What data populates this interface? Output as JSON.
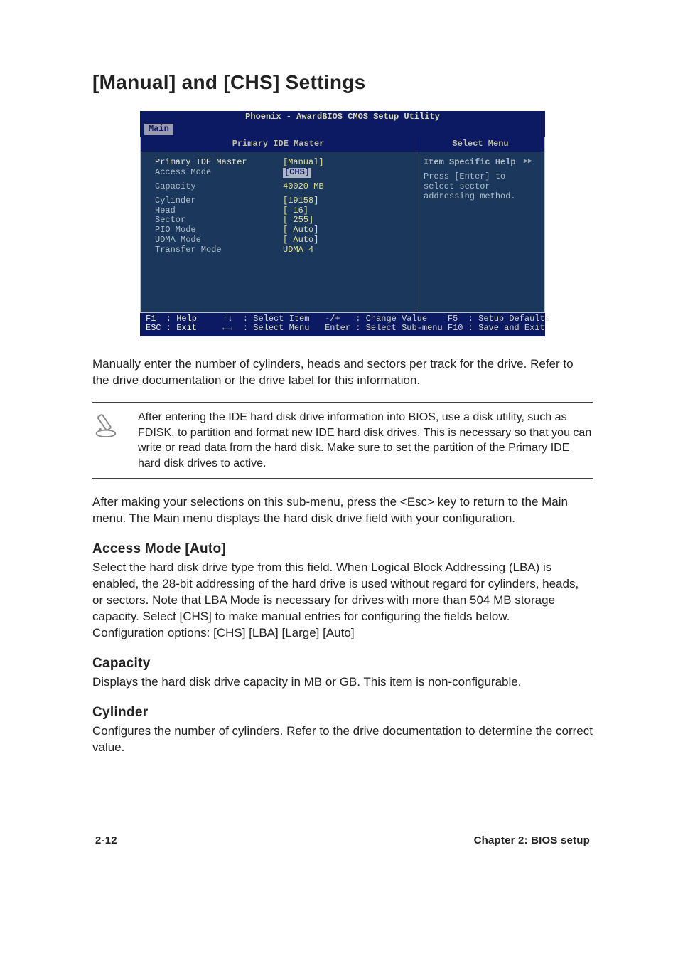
{
  "title": "[Manual] and [CHS] Settings",
  "bios": {
    "header": "Phoenix - AwardBIOS CMOS Setup Utility",
    "tab": "Main",
    "left_head": "Primary IDE Master",
    "right_head": "Select Menu",
    "rows": {
      "primary_label": "Primary IDE Master",
      "primary_val": "[Manual]",
      "access_label": "Access Mode",
      "access_val": "[CHS]",
      "capacity_label": "Capacity",
      "capacity_val": "40020 MB",
      "cylinder_label": "Cylinder",
      "cylinder_val": "[19158]",
      "head_label": "Head",
      "head_val": "[   16]",
      "sector_label": "Sector",
      "sector_val": "[  255]",
      "pio_label": "PIO Mode",
      "pio_val": "[ Auto]",
      "udma_label": "UDMA Mode",
      "udma_val": "[ Auto]",
      "transfer_label": "Transfer Mode",
      "transfer_val": "UDMA 4"
    },
    "help_title": "Item Specific Help",
    "help_text1": "Press [Enter] to",
    "help_text2": "select sector",
    "help_text3": "addressing method.",
    "footer_l1a": "F1  : Help",
    "footer_l1b": "↑↓  : Select Item",
    "footer_l1c": "-/+   : Change Value",
    "footer_l1d": "F5  : Setup Defaults",
    "footer_l2a": "ESC : Exit",
    "footer_l2b": "←→  : Select Menu",
    "footer_l2c": "Enter : Select Sub-menu",
    "footer_l2d": "F10 : Save and Exit"
  },
  "para1": "Manually enter the number of cylinders, heads and sectors per track for the drive. Refer to the drive documentation or the drive label for this information.",
  "note": "After entering the IDE hard disk drive information into BIOS, use a disk utility, such as FDISK, to partition and format new IDE hard disk drives. This is necessary so that you can write or read data from the hard disk. Make sure to set the partition of the Primary IDE hard disk drives to active.",
  "para2": "After making your selections on this sub-menu, press the <Esc> key to return to the Main menu. The Main menu displays the hard disk drive field with your configuration.",
  "sec_access_h": "Access Mode [Auto]",
  "sec_access_p": "Select the hard disk drive type from this field. When Logical Block Addressing (LBA) is enabled, the 28-bit addressing of the hard drive is used without regard for cylinders, heads, or sectors. Note that LBA Mode is necessary for drives with more than 504 MB storage capacity. Select [CHS] to make manual entries for configuring the fields below.\nConfiguration options: [CHS] [LBA] [Large] [Auto]",
  "sec_capacity_h": "Capacity",
  "sec_capacity_p": "Displays the hard disk drive capacity in MB or GB. This item is non-configurable.",
  "sec_cylinder_h": "Cylinder",
  "sec_cylinder_p": "Configures the number of cylinders. Refer to the drive documentation to determine the correct value.",
  "footer_left": "2-12",
  "footer_right": "Chapter 2: BIOS setup"
}
